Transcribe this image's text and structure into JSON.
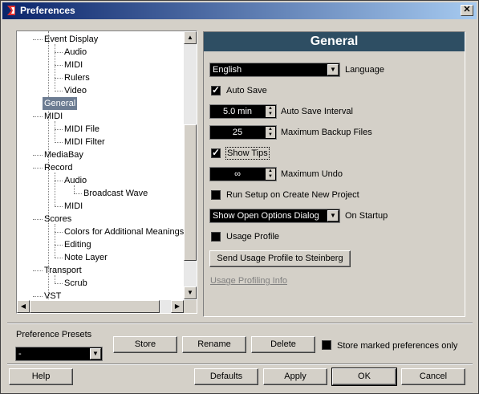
{
  "window": {
    "title": "Preferences"
  },
  "tree": {
    "items": [
      {
        "label": "Event Display"
      },
      {
        "label": "Audio"
      },
      {
        "label": "MIDI"
      },
      {
        "label": "Rulers"
      },
      {
        "label": "Video"
      },
      {
        "label": "General"
      },
      {
        "label": "MIDI"
      },
      {
        "label": "MIDI File"
      },
      {
        "label": "MIDI Filter"
      },
      {
        "label": "MediaBay"
      },
      {
        "label": "Record"
      },
      {
        "label": "Audio"
      },
      {
        "label": "Broadcast Wave"
      },
      {
        "label": "MIDI"
      },
      {
        "label": "Scores"
      },
      {
        "label": "Colors for Additional Meanings"
      },
      {
        "label": "Editing"
      },
      {
        "label": "Note Layer"
      },
      {
        "label": "Transport"
      },
      {
        "label": "Scrub"
      },
      {
        "label": "VST"
      }
    ],
    "selected": "General"
  },
  "panel": {
    "title": "General",
    "language": {
      "value": "English",
      "label": "Language"
    },
    "auto_save": {
      "label": "Auto Save",
      "checked": true
    },
    "auto_save_interval": {
      "value": "5.0 min",
      "label": "Auto Save Interval"
    },
    "max_backup": {
      "value": "25",
      "label": "Maximum Backup Files"
    },
    "show_tips": {
      "label": "Show Tips",
      "checked": true
    },
    "max_undo": {
      "value": "∞",
      "label": "Maximum Undo"
    },
    "run_setup": {
      "label": "Run Setup on Create New Project",
      "checked": false
    },
    "on_startup": {
      "value": "Show Open Options Dialog",
      "label": "On Startup"
    },
    "usage_profile": {
      "label": "Usage Profile",
      "checked": false
    },
    "send_usage_button": "Send Usage Profile to Steinberg",
    "usage_info_link": "Usage Profiling Info"
  },
  "presets": {
    "label": "Preference Presets",
    "value": "-",
    "store": "Store",
    "rename": "Rename",
    "delete": "Delete",
    "store_marked": {
      "label": "Store marked preferences only",
      "checked": false
    }
  },
  "footer": {
    "help": "Help",
    "defaults": "Defaults",
    "apply": "Apply",
    "ok": "OK",
    "cancel": "Cancel"
  },
  "colors": {
    "title_start": "#0a246a",
    "panel_header": "#2e4e63",
    "tree_selected": "#6c7c92",
    "dialog_bg": "#d4d0c8"
  }
}
